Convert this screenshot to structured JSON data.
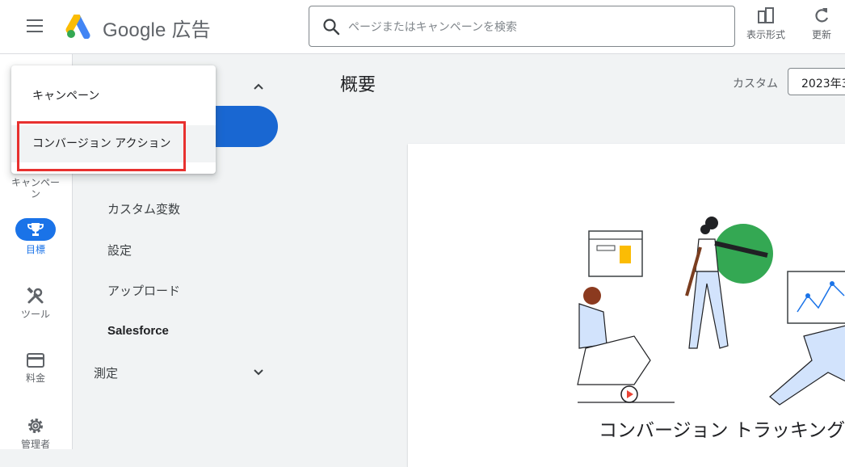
{
  "header": {
    "brand_text": "Google 広告",
    "search_placeholder": "ページまたはキャンペーンを検索",
    "view_button_label": "表示形式",
    "refresh_button_label": "更新"
  },
  "rail": {
    "campaign_label": "キャンペー\nン",
    "goals_label": "目標",
    "tools_label": "ツール",
    "billing_label": "料金",
    "admin_label": "管理者"
  },
  "dropdown": {
    "items": [
      "キャンペーン",
      "コンバージョン アクション"
    ],
    "selected_index": 1
  },
  "subnav": {
    "items": [
      "カスタム変数",
      "設定",
      "アップロード",
      "Salesforce"
    ],
    "measurement_label": "測定"
  },
  "main": {
    "title": "概要",
    "date_mode_label": "カスタム",
    "date_value": "2023年3",
    "card_title": "コンバージョン トラッキング"
  },
  "colors": {
    "accent": "#1a73e8",
    "highlight_border": "#e8312f"
  }
}
